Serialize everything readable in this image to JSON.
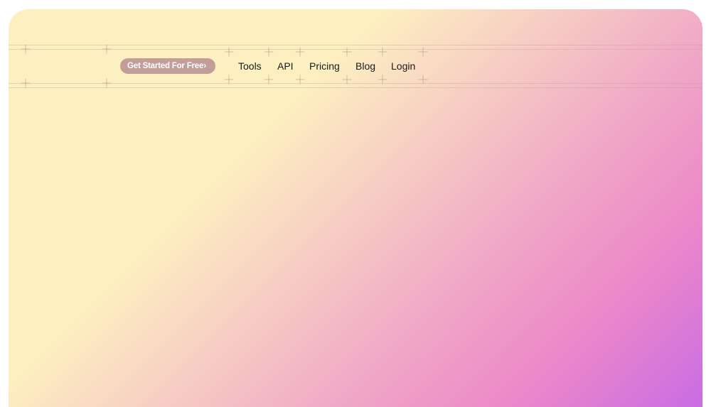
{
  "header": {
    "cta_label": "Get Started For Free",
    "cta_icon": "chevron-right-icon",
    "nav_items": [
      {
        "label": "Tools"
      },
      {
        "label": "API"
      },
      {
        "label": "Pricing"
      },
      {
        "label": "Blog"
      },
      {
        "label": "Login"
      }
    ]
  },
  "colors": {
    "gradient_start": "#fdf0c0",
    "gradient_mid": "#f0a9c6",
    "gradient_end": "#c96de4",
    "cta_background": "#c39e98",
    "nav_text": "#1a1a1a"
  }
}
